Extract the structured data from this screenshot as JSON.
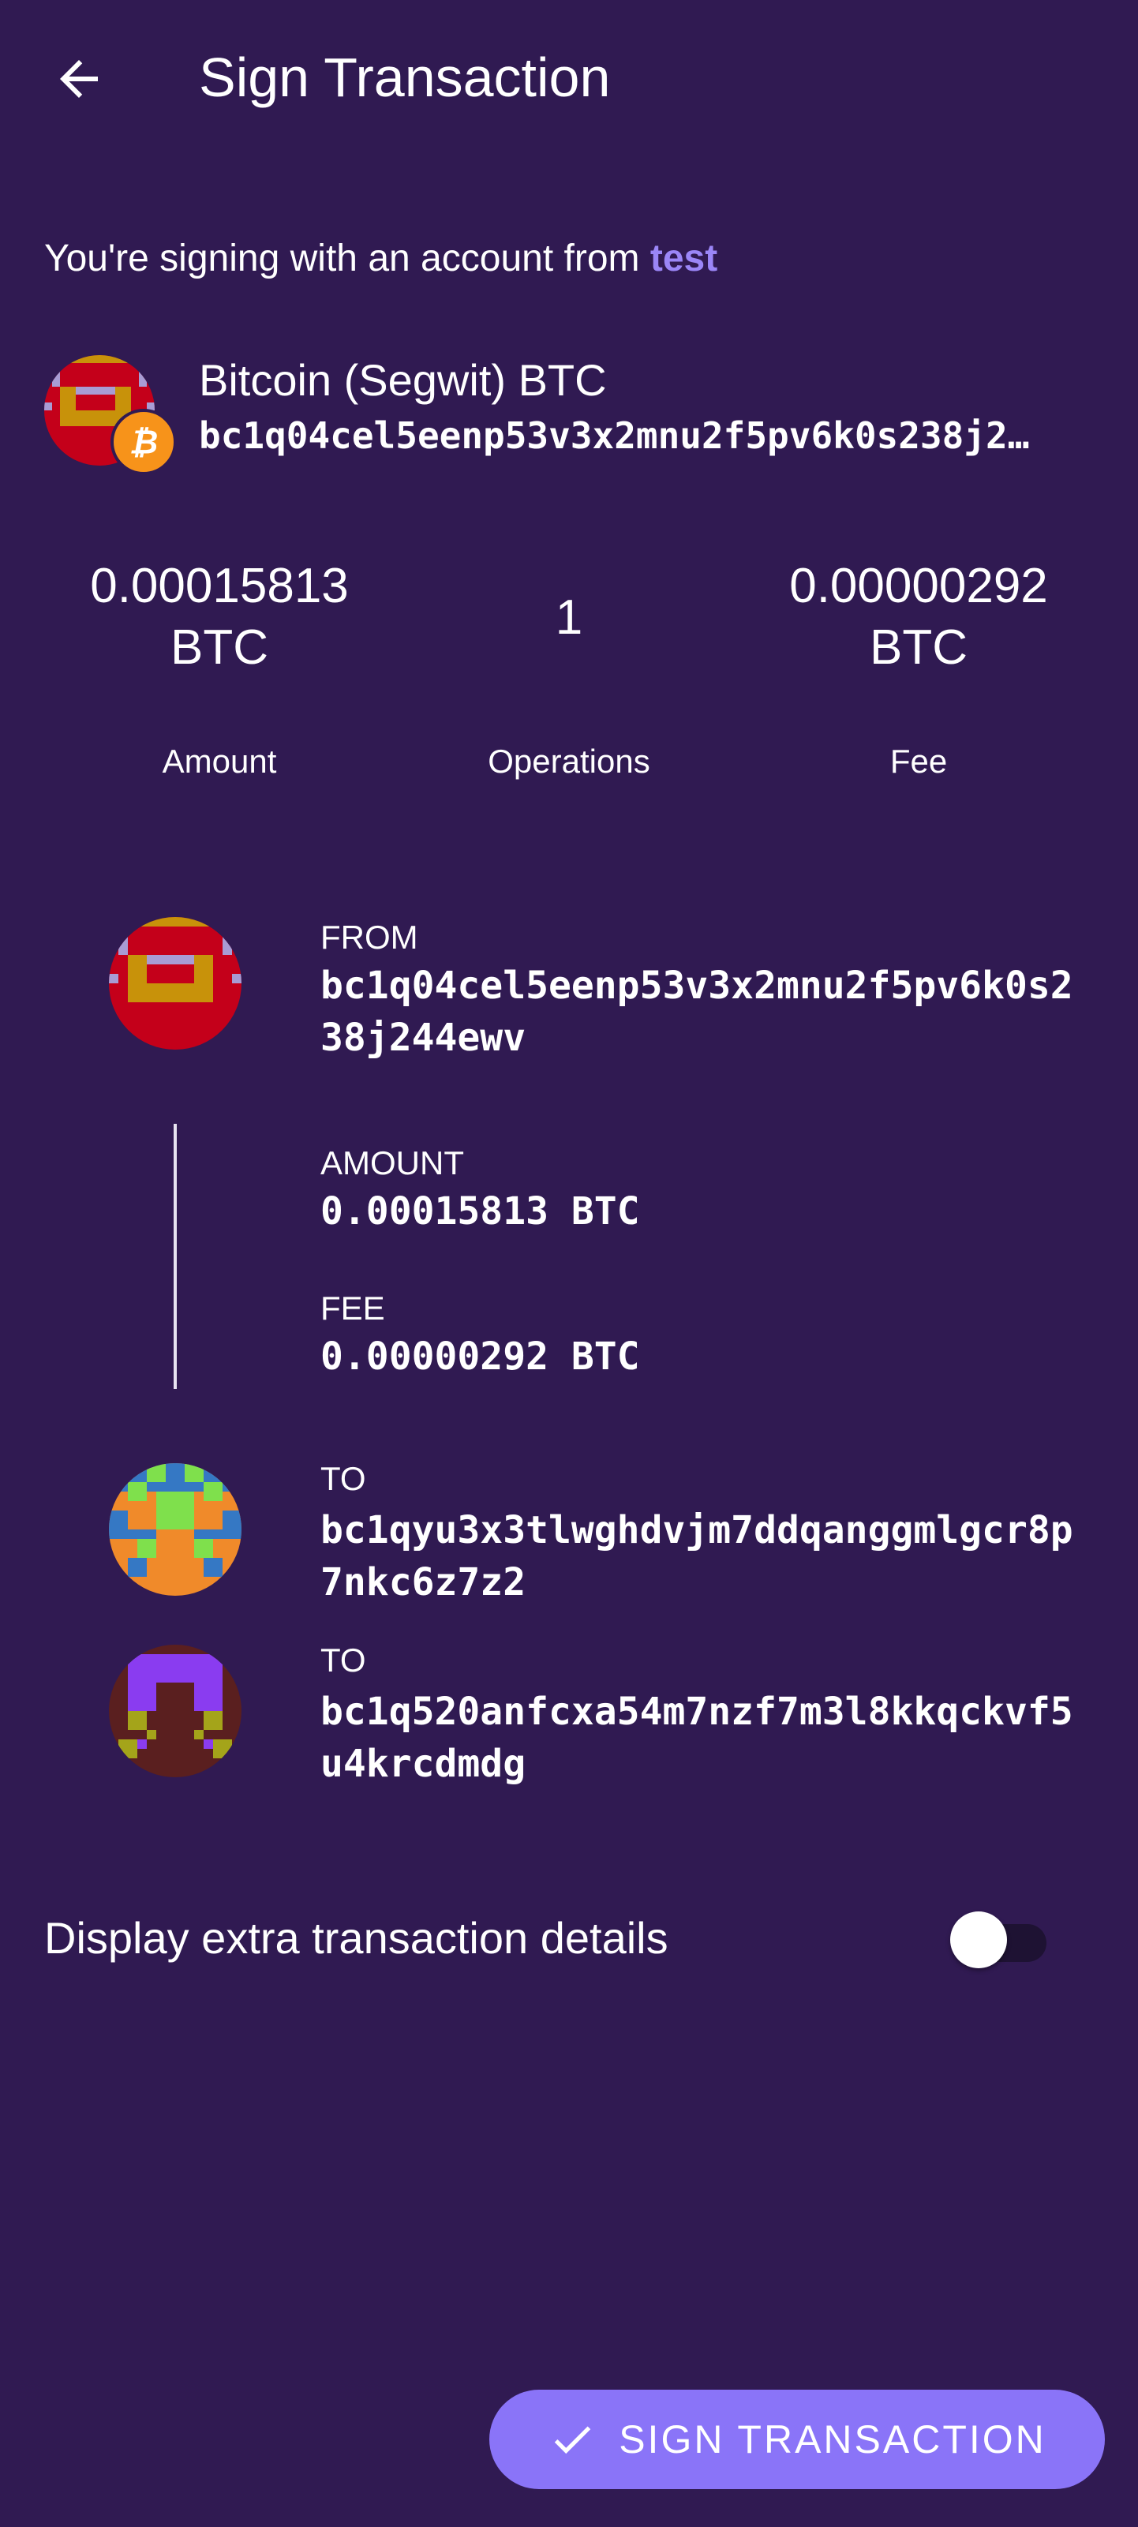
{
  "header": {
    "title": "Sign Transaction",
    "back_icon": "arrow-left-icon"
  },
  "signing": {
    "prefix": "You're signing with an account from ",
    "account": "test"
  },
  "account": {
    "name": "Bitcoin (Segwit) BTC",
    "address": "bc1q04cel5eenp53v3x2mnu2f5pv6k0s238j244ewv",
    "badge_icon": "bitcoin-icon"
  },
  "summary": {
    "amount": {
      "value": "0.00015813",
      "unit": "BTC",
      "label": "Amount"
    },
    "operations": {
      "value": "1",
      "label": "Operations"
    },
    "fee": {
      "value": "0.00000292",
      "unit": "BTC",
      "label": "Fee"
    }
  },
  "flow": {
    "from": {
      "label": "FROM",
      "address": "bc1q04cel5eenp53v3x2mnu2f5pv6k0s238j244ewv"
    },
    "amount": {
      "label": "AMOUNT",
      "value": "0.00015813 BTC"
    },
    "fee": {
      "label": "FEE",
      "value": "0.00000292 BTC"
    },
    "to": [
      {
        "label": "TO",
        "address": "bc1qyu3x3tlwghdvjm7ddqanggmlgcr8p7nkc6z7z2"
      },
      {
        "label": "TO",
        "address": "bc1q520anfcxa54m7nzf7m3l8kkqckvf5u4krcdmdg"
      }
    ]
  },
  "extra": {
    "label": "Display extra transaction details",
    "enabled": false
  },
  "sign_button": {
    "label": "SIGN TRANSACTION",
    "icon": "check-icon"
  },
  "colors": {
    "background": "#301a52",
    "accent": "#8a74f8",
    "account_highlight": "#9b86f7"
  }
}
